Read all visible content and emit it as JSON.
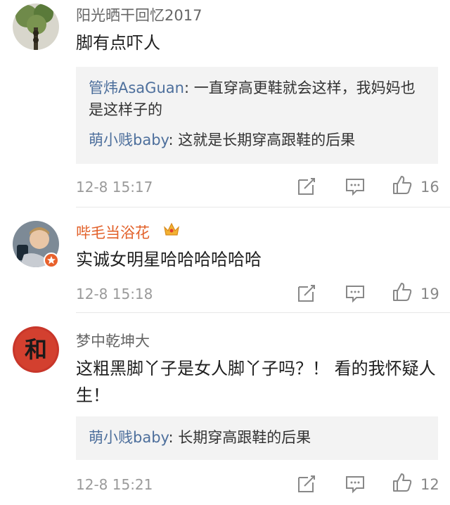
{
  "comments": [
    {
      "username": "阳光晒干回忆2017",
      "text": "脚有点吓人",
      "replies": [
        {
          "user": "管炜AsaGuan",
          "text": ": 一直穿高更鞋就会这样，我妈妈也是这样子的"
        },
        {
          "user": "萌小贱baby",
          "text": ": 这就是长期穿高跟鞋的后果"
        }
      ],
      "time": "12-8 15:17",
      "likes": "16"
    },
    {
      "username": "哔毛当浴花",
      "text": "实诚女明星哈哈哈哈哈哈",
      "replies": [],
      "time": "12-8 15:18",
      "likes": "19"
    },
    {
      "username": "梦中乾坤大",
      "text": "这粗黑脚丫子是女人脚丫子吗？！ 看的我怀疑人生！",
      "replies": [
        {
          "user": "萌小贱baby",
          "text": ": 长期穿高跟鞋的后果"
        }
      ],
      "time": "12-8 15:21",
      "likes": "12"
    }
  ],
  "avatar3_glyph": "和",
  "icons": [
    "repost-icon",
    "comment-icon",
    "like-icon",
    "crown-icon",
    "verified-badge-icon"
  ],
  "colors": {
    "reply_user": "#4d6f9c",
    "vip_name": "#e2612a",
    "meta": "#9a9a9a"
  }
}
